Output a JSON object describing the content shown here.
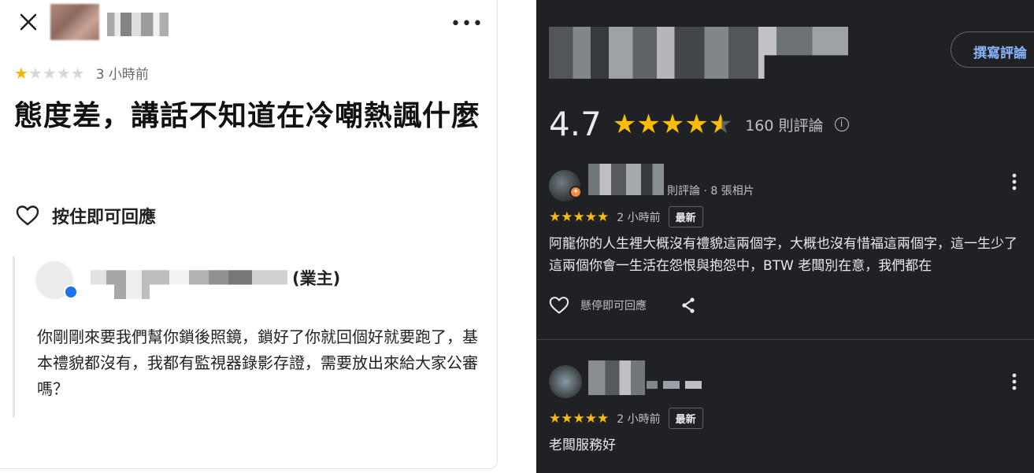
{
  "left_panel": {
    "time": "3 小時前",
    "rating": 1,
    "max_rating": 5,
    "title": "態度差，講話不知道在冷嘲熱諷什麼",
    "like_label": "按住即可回應",
    "reply": {
      "owner_tag": "(業主)",
      "text": "你剛剛來要我們幫你鎖後照鏡，鎖好了你就回個好就要跑了，基本禮貌都沒有，我都有監視器錄影存證，需要放出來給大家公審嗎？"
    }
  },
  "right_panel": {
    "write_review_label": "撰寫評論",
    "rating_value": "4.7",
    "rating_fraction": 0.94,
    "review_count": "160 則評論",
    "reviews": [
      {
        "meta": "則評論 · 8 張相片",
        "stars": 5,
        "time": "2 小時前",
        "badge": "最新",
        "text": "阿龍你的人生裡大概沒有禮貌這兩個字，大概也沒有惜福這兩個字，這一生少了這兩個你會一生活在怨恨與抱怨中，BTW 老闆別在意，我們都在",
        "like_label": "懸停即可回應"
      },
      {
        "stars": 5,
        "time": "2 小時前",
        "badge": "最新",
        "text": "老闆服務好"
      }
    ]
  },
  "colors": {
    "star_gold_left": "#f5b400",
    "star_gold_right": "#fbbc04",
    "link_blue": "#8ab4f8",
    "verified_blue": "#1a73e8",
    "dark_bg": "#202124"
  }
}
